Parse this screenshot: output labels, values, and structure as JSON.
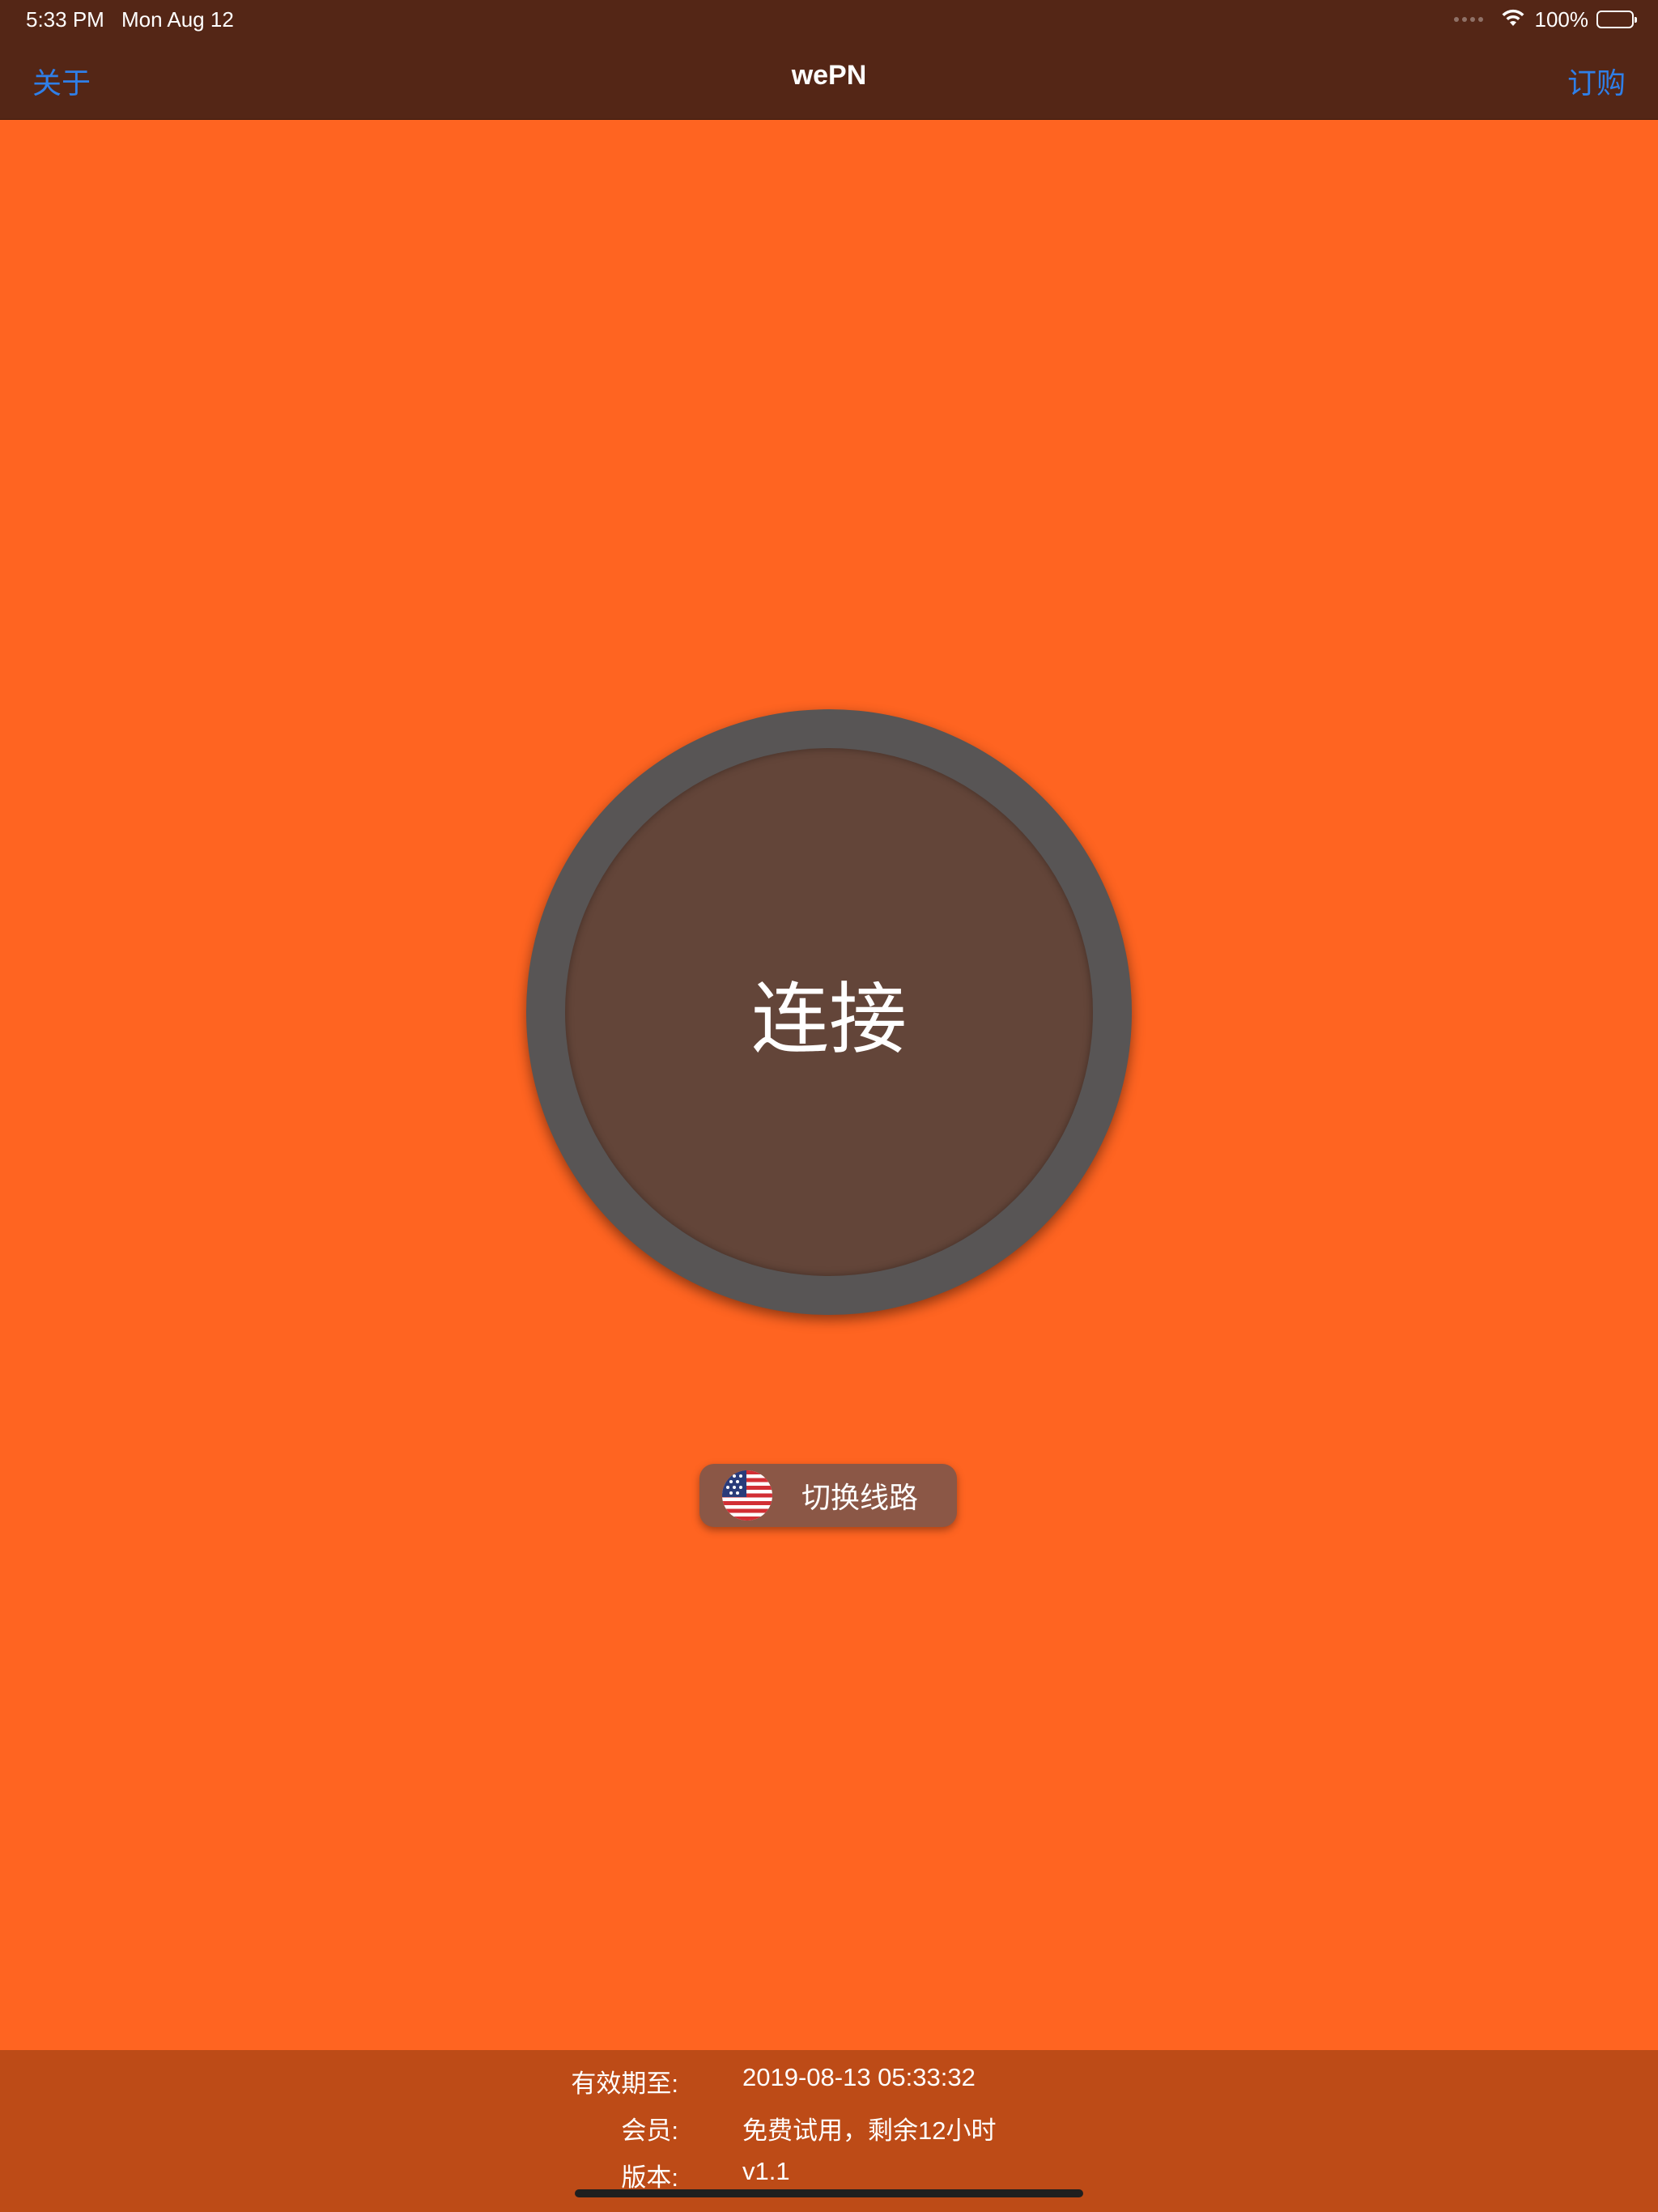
{
  "status_bar": {
    "time": "5:33 PM",
    "date": "Mon Aug 12",
    "battery": "100%",
    "battery_level": 1.0
  },
  "nav": {
    "left_label": "关于",
    "title": "wePN",
    "right_label": "订购"
  },
  "main": {
    "connect_label": "连接",
    "switch_route_label": "切换线路",
    "route_flag": "us-flag-icon"
  },
  "footer": {
    "rows": [
      {
        "label": "有效期至:",
        "value": "2019-08-13 05:33:32"
      },
      {
        "label": "会员:",
        "value": "免费试用，剩余12小时"
      },
      {
        "label": "版本:",
        "value": "v1.1"
      }
    ]
  },
  "colors": {
    "background": "#ff6421",
    "bar": "#542616",
    "link": "#2f7fe8",
    "ring": "#585555",
    "button_inner": "#634539",
    "footer": "#bd4b17"
  }
}
